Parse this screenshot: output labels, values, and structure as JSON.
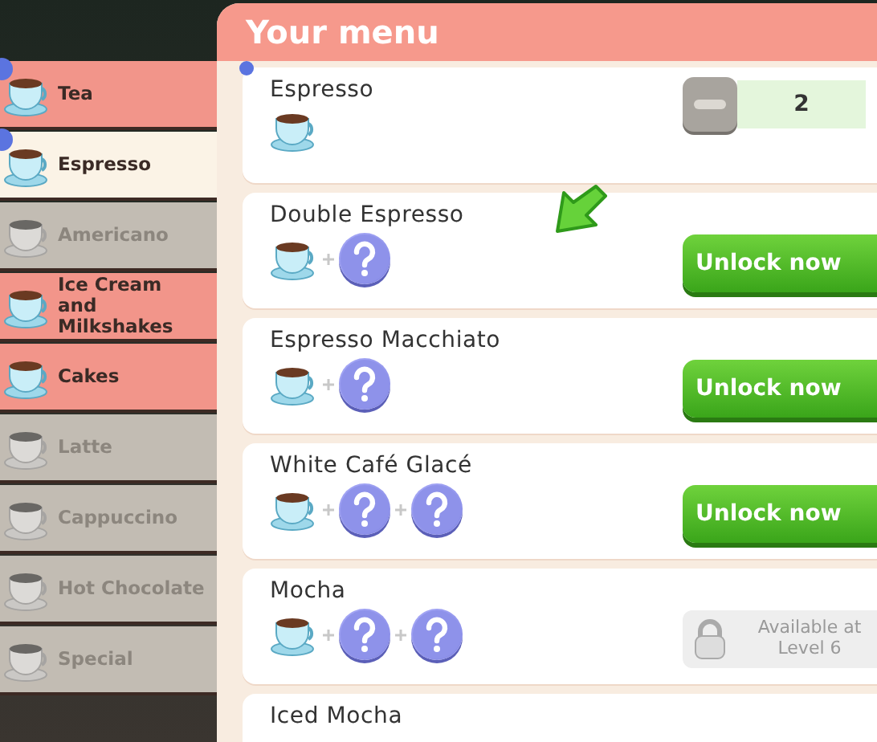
{
  "sidebar": {
    "items": [
      {
        "label": "Tea",
        "selected": false,
        "locked": false,
        "new": true
      },
      {
        "label": "Espresso",
        "selected": true,
        "locked": false,
        "new": true
      },
      {
        "label": "Americano",
        "selected": false,
        "locked": true,
        "new": false
      },
      {
        "label": "Ice Cream and Milkshakes",
        "selected": false,
        "locked": false,
        "new": false
      },
      {
        "label": "Cakes",
        "selected": false,
        "locked": false,
        "new": false
      },
      {
        "label": "Latte",
        "selected": false,
        "locked": true,
        "new": false
      },
      {
        "label": "Cappuccino",
        "selected": false,
        "locked": true,
        "new": false
      },
      {
        "label": "Hot Chocolate",
        "selected": false,
        "locked": true,
        "new": false
      },
      {
        "label": "Special",
        "selected": false,
        "locked": true,
        "new": false
      }
    ]
  },
  "menu": {
    "title": "Your menu",
    "items": [
      {
        "name": "Espresso",
        "new": true,
        "ingredients": [
          {
            "kind": "cup"
          }
        ],
        "action": {
          "kind": "stepper",
          "value": "2"
        }
      },
      {
        "name": "Double Espresso",
        "new": false,
        "ingredients": [
          {
            "kind": "cup"
          },
          {
            "kind": "unknown"
          }
        ],
        "action": {
          "kind": "unlock",
          "label": "Unlock now"
        }
      },
      {
        "name": "Espresso Macchiato",
        "new": false,
        "ingredients": [
          {
            "kind": "cup"
          },
          {
            "kind": "unknown"
          }
        ],
        "action": {
          "kind": "unlock",
          "label": "Unlock now"
        }
      },
      {
        "name": "White Café Glacé",
        "new": false,
        "ingredients": [
          {
            "kind": "cup"
          },
          {
            "kind": "unknown"
          },
          {
            "kind": "unknown"
          }
        ],
        "action": {
          "kind": "unlock",
          "label": "Unlock now"
        }
      },
      {
        "name": "Mocha",
        "new": false,
        "ingredients": [
          {
            "kind": "cup"
          },
          {
            "kind": "unknown"
          },
          {
            "kind": "unknown"
          }
        ],
        "action": {
          "kind": "locked",
          "label": "Available at Level 6"
        }
      },
      {
        "name": "Iced Mocha",
        "new": false
      }
    ]
  }
}
